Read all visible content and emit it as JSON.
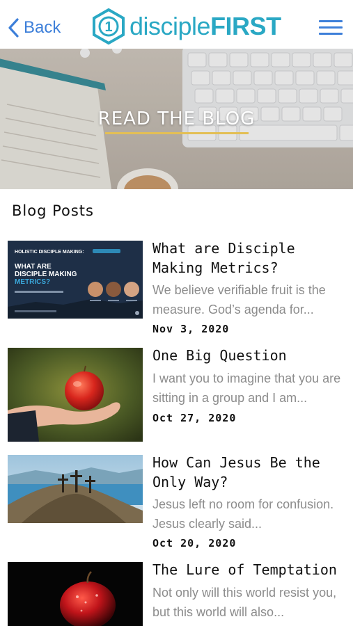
{
  "nav": {
    "back_label": "Back",
    "logo_text_light": "disciple",
    "logo_text_bold": "FIRST",
    "logo_mark": "1"
  },
  "hero": {
    "title": "READ THE BLOG"
  },
  "section": {
    "title": "Blog Posts"
  },
  "posts": [
    {
      "title": "What are Disciple Making Metrics?",
      "excerpt": "We believe verifiable fruit is the measure. God’s agenda for...",
      "date": "Nov 3, 2020",
      "thumb": {
        "kicker": "HOLISTIC DISCIPLE MAKING:",
        "headline_1": "WHAT ARE",
        "headline_2": "DISCIPLE MAKING",
        "headline_3": "METRICS?"
      }
    },
    {
      "title": "One Big Question",
      "excerpt": "I want you to imagine that you are sitting in a group and I am...",
      "date": "Oct 27, 2020"
    },
    {
      "title": "How Can Jesus Be the Only Way?",
      "excerpt": "Jesus left no room for confusion. Jesus clearly said...",
      "date": "Oct 20, 2020"
    },
    {
      "title": "The Lure of Temptation",
      "excerpt": "Not only will this world resist you, but this world will also...",
      "date": ""
    }
  ],
  "colors": {
    "accent_blue": "#3d7fd9",
    "brand_teal": "#2aa8c4",
    "hero_rule": "#e3bf55"
  }
}
